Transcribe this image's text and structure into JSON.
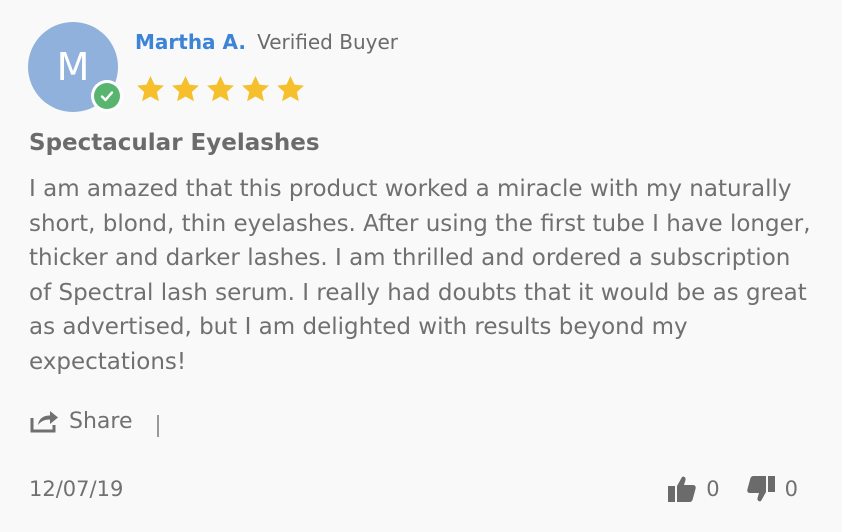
{
  "review": {
    "avatar_initial": "M",
    "author_name": "Martha A.",
    "buyer_label": "Verified Buyer",
    "rating": 5,
    "rating_max": 5,
    "title": "Spectacular Eyelashes",
    "body": "I am amazed that this product worked a miracle with my naturally short, blond, thin eyelashes. After using the first tube I have longer, thicker and darker lashes. I am thrilled and ordered a subscription of Spectral lash serum. I really had doubts that it would be as great as advertised, but I am delighted with results beyond my expectations!",
    "share_label": "Share",
    "date": "12/07/19",
    "thumbs_up_count": "0",
    "thumbs_down_count": "0"
  },
  "colors": {
    "avatar_bg": "#8fb1dc",
    "verified_green": "#58b56f",
    "author_blue": "#3d83d6",
    "star_gold": "#f5c02b",
    "text_gray": "#6b6b6b"
  },
  "icons": {
    "verified": "check-circle-icon",
    "star": "star-icon",
    "share": "share-arrow-icon",
    "thumbs_up": "thumbs-up-icon",
    "thumbs_down": "thumbs-down-icon"
  }
}
